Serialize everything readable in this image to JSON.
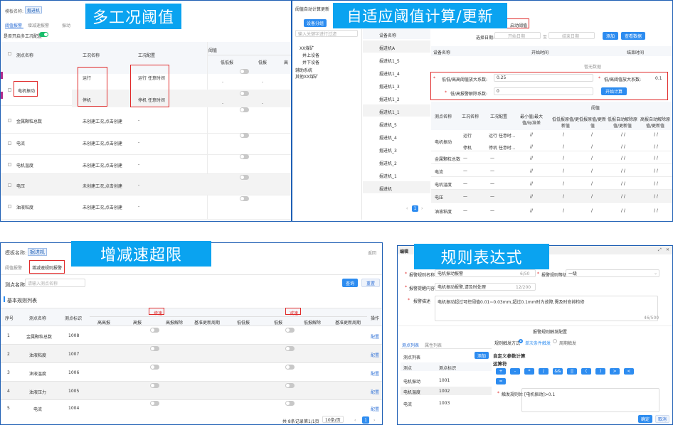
{
  "p1": {
    "banner": "多工况阈值",
    "model_label": "模板名称:",
    "model_value": "掘进机",
    "tabs": [
      "阈值报警",
      "增减速报警"
    ],
    "tab3_partial": "振动",
    "switch_label": "是否开启多工况配置",
    "headers": {
      "name": "测点名称",
      "condition": "工况名称",
      "config": "工况配置",
      "threshold": "阈值",
      "c1": "低低报",
      "c2": "低报",
      "c3": "高"
    },
    "rows": [
      {
        "name": "电机振动",
        "conditions": [
          {
            "name": "运行",
            "config": "运行 任意时间"
          },
          {
            "name": "停机",
            "config": "停机 任意时间"
          }
        ]
      },
      {
        "name": "金属颗粒总数",
        "condition": "未创建工况,点击创建",
        "config": "-"
      },
      {
        "name": "电流",
        "condition": "未创建工况,点击创建",
        "config": "-"
      },
      {
        "name": "电机温度",
        "condition": "未创建工况,点击创建",
        "config": "-"
      },
      {
        "name": "电压",
        "condition": "未创建工况,点击创建",
        "config": "-"
      },
      {
        "name": "油液粘度",
        "condition": "未创建工况,点击创建",
        "config": "-"
      }
    ]
  },
  "p2": {
    "banner": "自适应阈值计算/更新",
    "title": "阈值自动计算更新",
    "group_button": "设备分组",
    "search_placeholder": "输入关键字进行过滤",
    "tree": [
      "XX煤矿",
      "井上设备",
      "井下设备",
      "辅助系统",
      "其他XX煤矿"
    ],
    "device_header": "设备名称",
    "devices": [
      "掘进机A",
      "掘进机1_5",
      "掘进机1_4",
      "掘进机1_3",
      "掘进机1_2",
      "掘进机1_1",
      "掘进机_5",
      "掘进机_4",
      "掘进机_3",
      "掘进机_2",
      "掘进机_1",
      "掘进机"
    ],
    "pager": {
      "current": "1"
    },
    "redbox_label": "启动阈值",
    "date_label": "选择日期:",
    "start_placeholder": "开始日期",
    "end_placeholder": "结束日期",
    "add_button": "添加",
    "view_button": "查看数据",
    "table_headers": [
      "设备名称",
      "开始时间",
      "结束时间"
    ],
    "no_data": "暂无数据",
    "form": {
      "hh_label": "低低/高高阈值放大系数:",
      "hh_value": "0.25",
      "h_label": "低/高阈值放大系数:",
      "h_value": "0.1",
      "release_label": "低/高报警解除系数:",
      "release_value": "0",
      "calc_button": "开始计算"
    },
    "bottom_headers": {
      "name": "测点名称",
      "condition": "工况名称",
      "config": "工况配置",
      "range": "最小值/最大值/标准差",
      "threshold": "阈值",
      "t1": "低低报原值/更新值",
      "t2": "低报原值/更新值",
      "t3": "低报自动解除原值/更新值",
      "t4": "高报自动解除原值/更新值"
    },
    "bottom_rows": [
      {
        "name": "电机振动",
        "condition": "运行",
        "config": "运行 任意时...",
        "vals": [
          "//",
          "/",
          "/",
          "/ /",
          "/ /"
        ]
      },
      {
        "name": "",
        "condition": "停机",
        "config": "停机 任意时...",
        "vals": [
          "//",
          "/",
          "/",
          "/ /",
          "/ /"
        ]
      },
      {
        "name": "金属颗粒总数",
        "condition": "—",
        "config": "—",
        "vals": [
          "//",
          "/",
          "/",
          "/ /",
          "/ /"
        ]
      },
      {
        "name": "电流",
        "condition": "—",
        "config": "—",
        "vals": [
          "//",
          "/",
          "/",
          "/ /",
          "/ /"
        ]
      },
      {
        "name": "电机温度",
        "condition": "—",
        "config": "—",
        "vals": [
          "//",
          "/",
          "/",
          "/ /",
          "/ /"
        ]
      },
      {
        "name": "电压",
        "condition": "—",
        "config": "—",
        "vals": [
          "//",
          "/",
          "/",
          "/ /",
          "/ /"
        ]
      },
      {
        "name": "油液粘度",
        "condition": "—",
        "config": "—",
        "vals": [
          "//",
          "/",
          "/",
          "/ /",
          "/ /"
        ]
      }
    ]
  },
  "p3": {
    "banner": "增减速超限",
    "model_label": "模板名称:",
    "model_value": "掘进机",
    "return_label": "返回",
    "tabs": [
      "阈值报警",
      "增减速规则报警"
    ],
    "point_label": "测点名称:",
    "point_placeholder": "请输入测点名称",
    "query_button": "查询",
    "reset_button": "重置",
    "section_title": "基本规则列表",
    "headers": {
      "seq": "序号",
      "name": "测点名称",
      "code": "测点标识",
      "up": "增速",
      "down": "减速",
      "op": "操作",
      "sub_up": [
        "高高报",
        "高报",
        "高报解除",
        "基准更新周期"
      ],
      "sub_down": [
        "低低报",
        "低报",
        "低报解除",
        "基准更新周期"
      ]
    },
    "rows": [
      {
        "seq": "1",
        "name": "金属颗粒总数",
        "code": "1008",
        "op": "配置"
      },
      {
        "seq": "2",
        "name": "油液粘度",
        "code": "1007",
        "op": "配置"
      },
      {
        "seq": "3",
        "name": "油液温度",
        "code": "1006",
        "op": "配置"
      },
      {
        "seq": "4",
        "name": "油液压力",
        "code": "1005",
        "op": "配置"
      },
      {
        "seq": "5",
        "name": "电流",
        "code": "1004",
        "op": "配置"
      }
    ],
    "pager": {
      "total": "共 8条记录",
      "pages": "第1/1页",
      "size": "10条/页",
      "current": "1"
    }
  },
  "p4": {
    "banner": "规则表达式",
    "title": "编辑",
    "form": {
      "rule_name_label": "报警规则名称",
      "rule_name_value": "电机振动报警",
      "rule_name_count": "6/50",
      "level_label": "报警规则等级",
      "level_value": "一级",
      "content_label": "报警提醒内容",
      "content_value": "电机振动报警,请及时处理",
      "content_count": "12/200",
      "desc_label": "报警描述",
      "desc_value": "电机振动超过可控阈值0.01~0.03mm,超过0.1mm时为故障,需及时安排检修",
      "desc_count": "46/500"
    },
    "trigger_title": "报警规则触发配置",
    "trigger_mode_label": "规则触发方式",
    "trigger_modes": [
      "单次条件触发",
      "周期触发"
    ],
    "list_tabs": [
      "测点列表",
      "属性列表"
    ],
    "list_sub_label": "测点列表",
    "add_button": "添加",
    "list_headers": [
      "测点",
      "测点标识"
    ],
    "list_rows": [
      {
        "name": "电机振动",
        "code": "1001"
      },
      {
        "name": "电机温度",
        "code": "1002"
      },
      {
        "name": "电流",
        "code": "1003"
      }
    ],
    "expr_title": "自定义参数计算",
    "operator_label": "运算符",
    "operators": [
      "+",
      "-",
      "*",
      "/",
      "&&",
      "||",
      "(",
      ")",
      ">",
      "<",
      "="
    ],
    "trigger_rule_label": "触发规则体",
    "trigger_rule_value": "[电机振动]>0.1",
    "ok_button": "确定",
    "cancel_button": "取消"
  }
}
